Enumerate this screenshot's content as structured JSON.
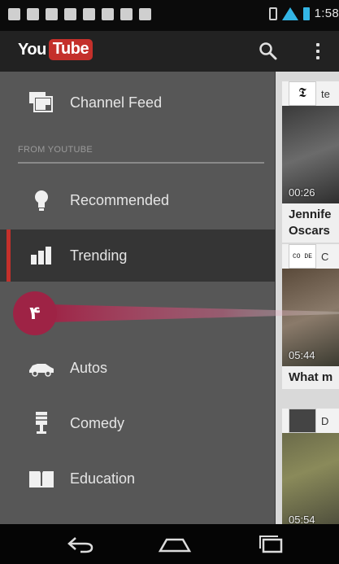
{
  "status_bar": {
    "time": "1:58"
  },
  "action_bar": {
    "logo_you": "You",
    "logo_tube": "Tube",
    "search_icon": "search-icon",
    "overflow_icon": "overflow-menu-icon"
  },
  "drawer": {
    "top_item": {
      "label": "Channel Feed",
      "icon": "channel-feed-icon"
    },
    "section_header": "FROM YOUTUBE",
    "items": [
      {
        "label": "Recommended",
        "icon": "lightbulb-icon",
        "active": false
      },
      {
        "label": "Trending",
        "icon": "bar-chart-icon",
        "active": true
      },
      {
        "label": "",
        "icon": "music-icon",
        "active": false
      },
      {
        "label": "Autos",
        "icon": "car-icon",
        "active": false
      },
      {
        "label": "Comedy",
        "icon": "microphone-icon",
        "active": false
      },
      {
        "label": "Education",
        "icon": "book-icon",
        "active": false
      }
    ]
  },
  "callout": {
    "text": "۴"
  },
  "feed": {
    "cards": [
      {
        "channel_text": "te",
        "avatar_text": "𝕿",
        "duration": "00:26",
        "title_line1": "Jennife",
        "title_line2": "Oscars"
      },
      {
        "channel_text": "C",
        "avatar_text": "CO DE",
        "duration": "05:44",
        "title_line1": "What m",
        "title_line2": ""
      },
      {
        "channel_text": "D",
        "avatar_text": "",
        "duration": "05:54",
        "title_line1": "",
        "title_line2": ""
      }
    ]
  },
  "nav_bar": {
    "back_icon": "back-icon",
    "home_icon": "home-icon",
    "recents_icon": "recent-apps-icon"
  },
  "colors": {
    "brand_red": "#c4302b",
    "drawer_bg": "#575757",
    "active_bg": "#353535",
    "callout": "#9e2345",
    "status_accent": "#33b5e5"
  }
}
